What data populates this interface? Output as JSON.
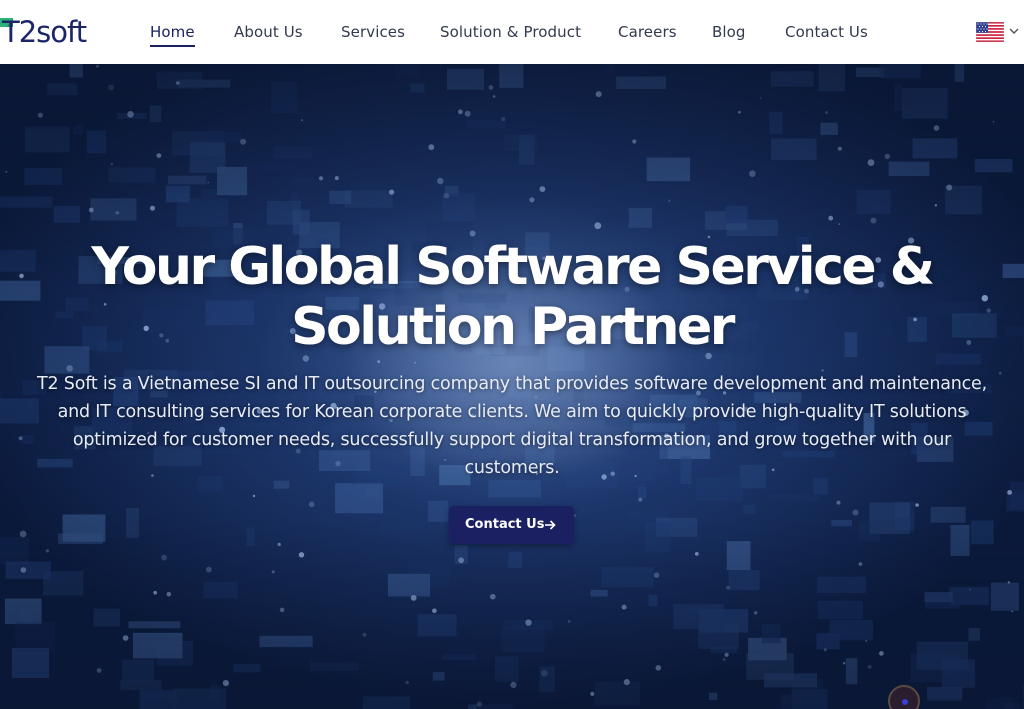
{
  "header": {
    "logo_text": "T2soft",
    "nav": [
      {
        "label": "Home",
        "active": true
      },
      {
        "label": "About Us",
        "active": false
      },
      {
        "label": "Services",
        "active": false
      },
      {
        "label": "Solution & Product",
        "active": false
      },
      {
        "label": "Careers",
        "active": false
      },
      {
        "label": "Blog",
        "active": false
      },
      {
        "label": "Contact Us",
        "active": false
      }
    ],
    "language": {
      "icon": "us-flag-icon",
      "dropdown_icon": "chevron-down-icon"
    }
  },
  "hero": {
    "title_line1": "Your Global Software Service &",
    "title_line2": "Solution Partner",
    "description_lines": [
      "T2 Soft is a Vietnamese SI and IT outsourcing company that provides software development and maintenance,",
      "and IT consulting services for Korean corporate clients. We aim to quickly provide high-quality IT solutions",
      "optimized for customer needs, successfully support digital transformation, and grow together with our",
      "customers."
    ],
    "cta_label": "Contact Us",
    "cta_icon": "arrow-right-icon"
  },
  "colors": {
    "brand_navy": "#1b2568",
    "logo_green": "#2bb37a",
    "hero_dark": "#0c1c3f",
    "button_bg": "#1b2062"
  }
}
